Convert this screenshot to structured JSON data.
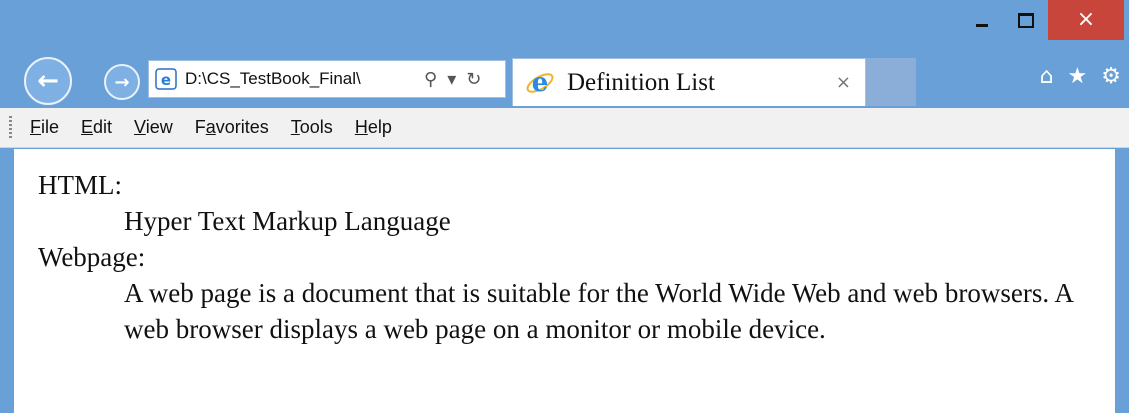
{
  "window": {
    "minimize_icon": "minimize-icon",
    "maximize_icon": "maximize-icon",
    "close_label": "×"
  },
  "nav": {
    "back_arrow": "←",
    "forward_arrow": "→",
    "address": "D:\\CS_TestBook_Final\\",
    "search_glyph": "⚲",
    "dropdown_glyph": "▾",
    "refresh_glyph": "↻"
  },
  "tab": {
    "title": "Definition List",
    "close_label": "×"
  },
  "toolbar_icons": {
    "home": "⌂",
    "favorites": "★",
    "settings": "⚙"
  },
  "menu": {
    "items": [
      {
        "first": "F",
        "rest": "ile"
      },
      {
        "first": "E",
        "rest": "dit"
      },
      {
        "first": "V",
        "rest": "iew"
      },
      {
        "first": "F",
        "rest": "avorites",
        "pre": ""
      },
      {
        "first": "T",
        "rest": "ools"
      },
      {
        "first": "H",
        "rest": "elp"
      }
    ],
    "favorites_pre": "F",
    "favorites_u": "a",
    "favorites_rest": "vorites"
  },
  "content": {
    "terms": [
      {
        "term": "HTML:",
        "definition": "Hyper Text Markup Language"
      },
      {
        "term": "Webpage:",
        "definition": "A web page is a document that is suitable for the World Wide Web and web browsers. A web browser displays a web page on a monitor or mobile device."
      }
    ]
  },
  "colors": {
    "frame": "#6aa0d8",
    "close_button": "#c7453a",
    "menubar": "#f1f1f1"
  }
}
